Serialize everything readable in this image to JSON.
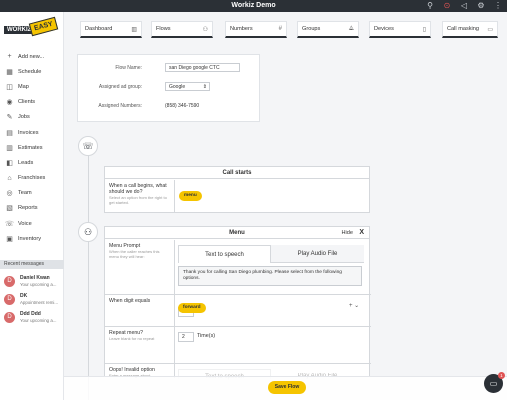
{
  "app": {
    "title": "Workiz Demo"
  },
  "topbar_icons": [
    "search-icon",
    "alert-icon",
    "megaphone-icon",
    "settings-icon",
    "more-icon"
  ],
  "logo": {
    "text_1": "WORKIZ",
    "text_2": "EASY"
  },
  "sidebar": {
    "items": [
      {
        "label": "Add new...",
        "icon": "+"
      },
      {
        "label": "Schedule",
        "icon": "▦"
      },
      {
        "label": "Map",
        "icon": "◫"
      },
      {
        "label": "Clients",
        "icon": "◉"
      },
      {
        "label": "Jobs",
        "icon": "✎"
      },
      {
        "label": "Invoices",
        "icon": "▤"
      },
      {
        "label": "Estimates",
        "icon": "▥"
      },
      {
        "label": "Leads",
        "icon": "◧"
      },
      {
        "label": "Franchises",
        "icon": "⌂"
      },
      {
        "label": "Team",
        "icon": "◎"
      },
      {
        "label": "Reports",
        "icon": "▧"
      },
      {
        "label": "Voice",
        "icon": "☏"
      },
      {
        "label": "Inventory",
        "icon": "▣"
      }
    ],
    "recent_header": "Recent messages",
    "messages": [
      {
        "avatar": "D",
        "name": "Daniel Kwan",
        "preview": "Your upcoming a..."
      },
      {
        "avatar": "D",
        "name": "DK",
        "preview": "Appointment remi..."
      },
      {
        "avatar": "D",
        "name": "Ddd Ddd",
        "preview": "Your upcoming a..."
      }
    ]
  },
  "tabs": [
    {
      "label": "Dashboard",
      "icon": "▥"
    },
    {
      "label": "Flows",
      "icon": "⚇"
    },
    {
      "label": "Numbers",
      "icon": "#"
    },
    {
      "label": "Groups",
      "icon": "⟁"
    },
    {
      "label": "Devices",
      "icon": "▯"
    },
    {
      "label": "Call masking",
      "icon": "▭"
    }
  ],
  "flow_form": {
    "name_label": "Flow Name:",
    "name_value": "san Diego google CTC",
    "group_label": "Assigned ad group:",
    "group_value": "Google",
    "numbers_label": "Assigned Numbers:",
    "numbers_value": "(858) 346-7590"
  },
  "call_starts": {
    "title": "Call starts",
    "question": "When a call begins, what should we do?",
    "hint": "Select an option from the right to get started.",
    "action": "menu"
  },
  "menu": {
    "title": "Menu",
    "hide_label": "Hide",
    "close_label": "X",
    "prompt_label": "Menu Prompt",
    "prompt_hint": "When the caller reaches this menu they will hear:",
    "tab_tts": "Text to speech",
    "tab_audio": "Play Audio File",
    "prompt_text": "Thank you for calling San Diego plumbing. Please select from the following options.",
    "digit_label": "When digit equals",
    "digit_value": "1",
    "digit_action": "forward",
    "add_label": "+ ⌄",
    "repeat_label": "Repeat menu?",
    "repeat_hint": "Leave blank for no repeat",
    "repeat_value": "2",
    "repeat_unit": "Time(s)",
    "invalid_label": "Oops! Invalid option",
    "invalid_hint": "Enter a message about",
    "invalid_tab_tts": "Text to speech",
    "invalid_tab_audio": "Play Audio File"
  },
  "save_button": "Save Flow",
  "chat": {
    "badge": "1"
  }
}
